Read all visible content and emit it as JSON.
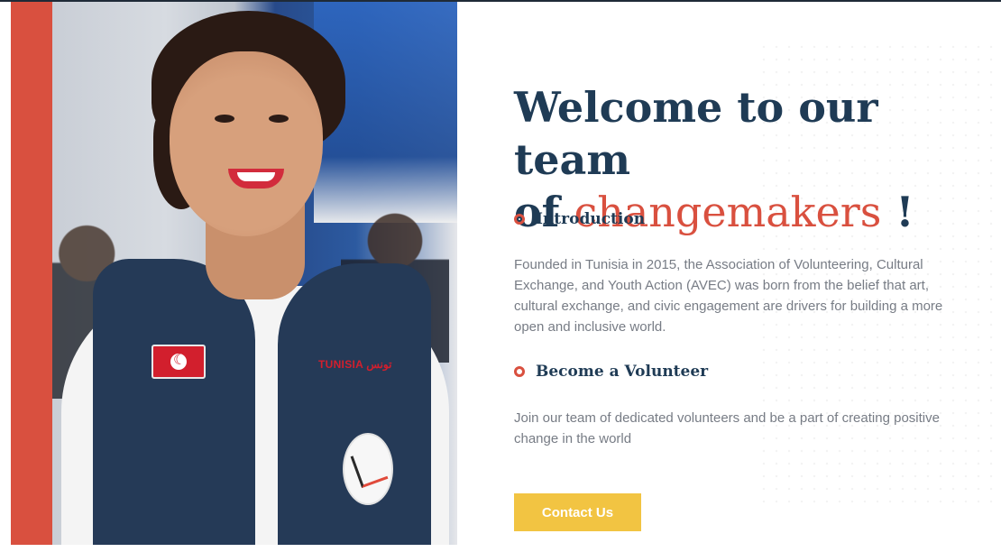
{
  "hero": {
    "title_line1": "Welcome to our team",
    "title_line2_prefix": "of ",
    "title_line2_accent": "changemakers",
    "title_line2_suffix": " !",
    "colors": {
      "primary": "#1f3b55",
      "accent": "#d9503f",
      "cta": "#f2c442"
    }
  },
  "photo": {
    "vest_text": "TUNISIA تونس"
  },
  "sections": [
    {
      "title": "Introduction",
      "text": "Founded in Tunisia in 2015, the Association of Volunteering, Cultural Exchange, and Youth Action (AVEC) was born from the belief that art, cultural exchange, and civic engagement are drivers for building a more open and inclusive world."
    },
    {
      "title": "Become a Volunteer",
      "text": "Join our team of dedicated volunteers and be a part of creating positive change in the world"
    }
  ],
  "cta": {
    "label": "Contact Us"
  }
}
